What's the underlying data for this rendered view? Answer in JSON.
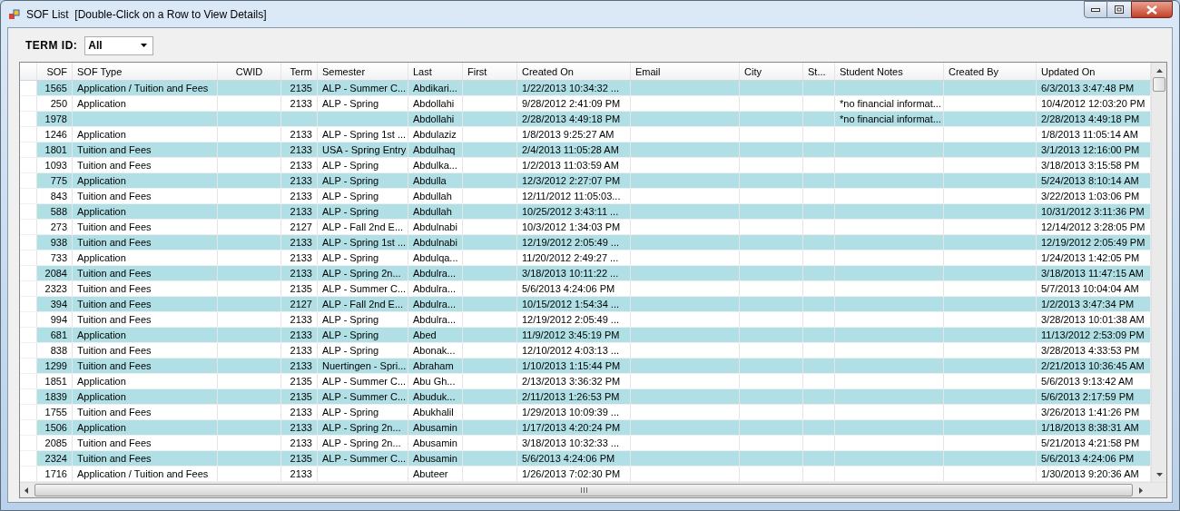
{
  "window": {
    "title": "SOF List  [Double-Click on a Row to View Details]"
  },
  "filter": {
    "label": "TERM ID:",
    "value": "All"
  },
  "table": {
    "columns": [
      "SOF",
      "SOF Type",
      "CWID",
      "Term",
      "Semester",
      "Last",
      "First",
      "Created On",
      "Email",
      "City",
      "St...",
      "Student Notes",
      "Created By",
      "Updated On"
    ],
    "rows": [
      {
        "sof": "1565",
        "sof_type": "Application / Tuition and Fees",
        "term": "2135",
        "semester": "ALP - Summer C...",
        "last": "Abdikari...",
        "created_on": "1/22/2013 10:34:32 ...",
        "updated_on": "6/3/2013 3:47:48 PM"
      },
      {
        "sof": "250",
        "sof_type": "Application",
        "term": "2133",
        "semester": "ALP - Spring",
        "last": "Abdollahi",
        "created_on": "9/28/2012 2:41:09 PM",
        "student_notes": "*no financial informat...",
        "updated_on": "10/4/2012 12:03:20 PM"
      },
      {
        "sof": "1978",
        "last": "Abdollahi",
        "created_on": "2/28/2013 4:49:18 PM",
        "student_notes": "*no financial informat...",
        "updated_on": "2/28/2013 4:49:18 PM"
      },
      {
        "sof": "1246",
        "sof_type": "Application",
        "term": "2133",
        "semester": "ALP - Spring 1st ...",
        "last": "Abdulaziz",
        "created_on": "1/8/2013 9:25:27 AM",
        "updated_on": "1/8/2013 11:05:14 AM"
      },
      {
        "sof": "1801",
        "sof_type": "Tuition and Fees",
        "term": "2133",
        "semester": "USA - Spring Entry",
        "last": "Abdulhaq",
        "created_on": "2/4/2013 11:05:28 AM",
        "updated_on": "3/1/2013 12:16:00 PM"
      },
      {
        "sof": "1093",
        "sof_type": "Tuition and Fees",
        "term": "2133",
        "semester": "ALP - Spring",
        "last": "Abdulka...",
        "created_on": "1/2/2013 11:03:59 AM",
        "updated_on": "3/18/2013 3:15:58 PM"
      },
      {
        "sof": "775",
        "sof_type": "Application",
        "term": "2133",
        "semester": "ALP - Spring",
        "last": "Abdulla",
        "created_on": "12/3/2012 2:27:07 PM",
        "updated_on": "5/24/2013 8:10:14 AM"
      },
      {
        "sof": "843",
        "sof_type": "Tuition and Fees",
        "term": "2133",
        "semester": "ALP - Spring",
        "last": "Abdullah",
        "created_on": "12/11/2012 11:05:03...",
        "updated_on": "3/22/2013 1:03:06 PM"
      },
      {
        "sof": "588",
        "sof_type": "Application",
        "term": "2133",
        "semester": "ALP - Spring",
        "last": "Abdullah",
        "created_on": "10/25/2012 3:43:11 ...",
        "updated_on": "10/31/2012 3:11:36 PM"
      },
      {
        "sof": "273",
        "sof_type": "Tuition and Fees",
        "term": "2127",
        "semester": "ALP - Fall 2nd E...",
        "last": "Abdulnabi",
        "created_on": "10/3/2012 1:34:03 PM",
        "updated_on": "12/14/2012 3:28:05 PM"
      },
      {
        "sof": "938",
        "sof_type": "Tuition and Fees",
        "term": "2133",
        "semester": "ALP - Spring 1st ...",
        "last": "Abdulnabi",
        "created_on": "12/19/2012 2:05:49 ...",
        "updated_on": "12/19/2012 2:05:49 PM"
      },
      {
        "sof": "733",
        "sof_type": "Application",
        "term": "2133",
        "semester": "ALP - Spring",
        "last": "Abdulqa...",
        "created_on": "11/20/2012 2:49:27 ...",
        "updated_on": "1/24/2013 1:42:05 PM"
      },
      {
        "sof": "2084",
        "sof_type": "Tuition and Fees",
        "term": "2133",
        "semester": "ALP - Spring 2n...",
        "last": "Abdulra...",
        "created_on": "3/18/2013 10:11:22 ...",
        "updated_on": "3/18/2013 11:47:15 AM"
      },
      {
        "sof": "2323",
        "sof_type": "Tuition and Fees",
        "term": "2135",
        "semester": "ALP - Summer C...",
        "last": "Abdulra...",
        "created_on": "5/6/2013 4:24:06 PM",
        "updated_on": "5/7/2013 10:04:04 AM"
      },
      {
        "sof": "394",
        "sof_type": "Tuition and Fees",
        "term": "2127",
        "semester": "ALP - Fall 2nd E...",
        "last": "Abdulra...",
        "created_on": "10/15/2012 1:54:34 ...",
        "updated_on": "1/2/2013 3:47:34 PM"
      },
      {
        "sof": "994",
        "sof_type": "Tuition and Fees",
        "term": "2133",
        "semester": "ALP - Spring",
        "last": "Abdulra...",
        "created_on": "12/19/2012 2:05:49 ...",
        "updated_on": "3/28/2013 10:01:38 AM"
      },
      {
        "sof": "681",
        "sof_type": "Application",
        "term": "2133",
        "semester": "ALP - Spring",
        "last": "Abed",
        "created_on": "11/9/2012 3:45:19 PM",
        "updated_on": "11/13/2012 2:53:09 PM"
      },
      {
        "sof": "838",
        "sof_type": "Tuition and Fees",
        "term": "2133",
        "semester": "ALP - Spring",
        "last": "Abonak...",
        "created_on": "12/10/2012 4:03:13 ...",
        "updated_on": "3/28/2013 4:33:53 PM"
      },
      {
        "sof": "1299",
        "sof_type": "Tuition and Fees",
        "term": "2133",
        "semester": "Nuertingen - Spri...",
        "last": "Abraham",
        "created_on": "1/10/2013 1:15:44 PM",
        "updated_on": "2/21/2013 10:36:45 AM"
      },
      {
        "sof": "1851",
        "sof_type": "Application",
        "term": "2135",
        "semester": "ALP - Summer C...",
        "last": "Abu Gh...",
        "created_on": "2/13/2013 3:36:32 PM",
        "updated_on": "5/6/2013 9:13:42 AM"
      },
      {
        "sof": "1839",
        "sof_type": "Application",
        "term": "2135",
        "semester": "ALP - Summer C...",
        "last": "Abuduk...",
        "created_on": "2/11/2013 1:26:53 PM",
        "updated_on": "5/6/2013 2:17:59 PM"
      },
      {
        "sof": "1755",
        "sof_type": "Tuition and Fees",
        "term": "2133",
        "semester": "ALP - Spring",
        "last": "Abukhalil",
        "created_on": "1/29/2013 10:09:39 ...",
        "updated_on": "3/26/2013 1:41:26 PM"
      },
      {
        "sof": "1506",
        "sof_type": "Application",
        "term": "2133",
        "semester": "ALP - Spring 2n...",
        "last": "Abusamin",
        "created_on": "1/17/2013 4:20:24 PM",
        "updated_on": "1/18/2013 8:38:31 AM"
      },
      {
        "sof": "2085",
        "sof_type": "Tuition and Fees",
        "term": "2133",
        "semester": "ALP - Spring 2n...",
        "last": "Abusamin",
        "created_on": "3/18/2013 10:32:33 ...",
        "updated_on": "5/21/2013 4:21:58 PM"
      },
      {
        "sof": "2324",
        "sof_type": "Tuition and Fees",
        "term": "2135",
        "semester": "ALP - Summer C...",
        "last": "Abusamin",
        "created_on": "5/6/2013 4:24:06 PM",
        "updated_on": "5/6/2013 4:24:06 PM"
      },
      {
        "sof": "1716",
        "sof_type": "Application / Tuition and Fees",
        "term": "2133",
        "last": "Abuteer",
        "created_on": "1/26/2013 7:02:30 PM",
        "updated_on": "1/30/2013 9:20:36 AM"
      }
    ]
  }
}
